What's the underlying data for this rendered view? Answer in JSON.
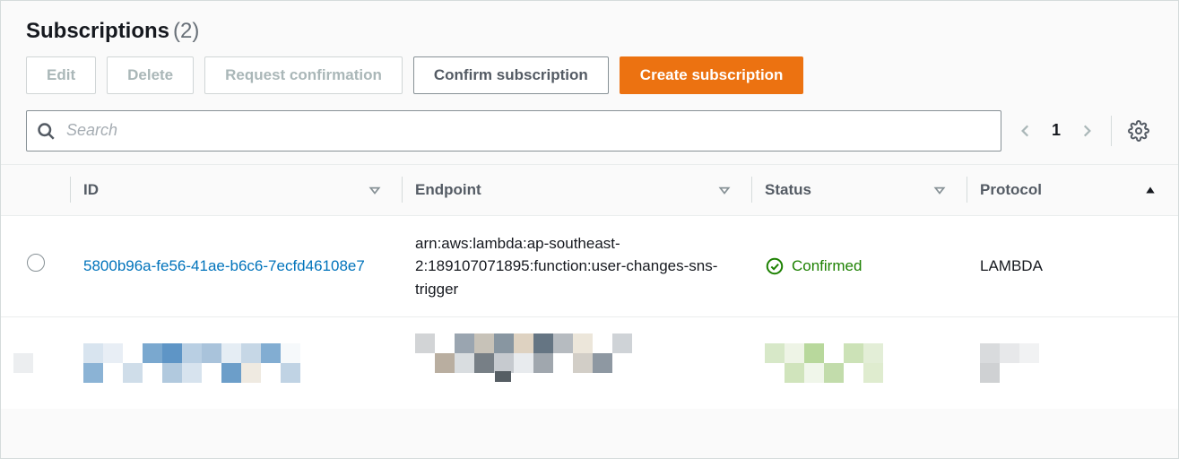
{
  "header": {
    "title": "Subscriptions",
    "count": "(2)"
  },
  "buttons": {
    "edit": "Edit",
    "delete": "Delete",
    "request_confirmation": "Request confirmation",
    "confirm_subscription": "Confirm subscription",
    "create_subscription": "Create subscription"
  },
  "search": {
    "placeholder": "Search"
  },
  "pagination": {
    "page": "1"
  },
  "columns": {
    "id": "ID",
    "endpoint": "Endpoint",
    "status": "Status",
    "protocol": "Protocol"
  },
  "rows": [
    {
      "id": "5800b96a-fe56-41ae-b6c6-7ecfd46108e7",
      "endpoint": "arn:aws:lambda:ap-southeast-2:189107071895:function:user-changes-sns-trigger",
      "status": "Confirmed",
      "protocol": "LAMBDA"
    }
  ]
}
